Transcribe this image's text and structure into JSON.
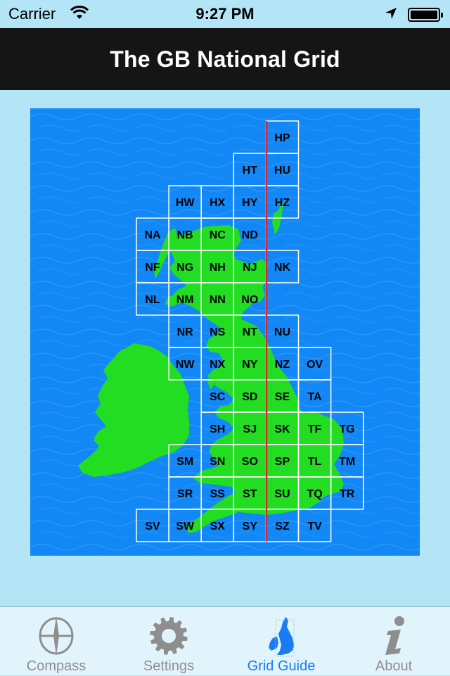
{
  "status_bar": {
    "carrier": "Carrier",
    "time": "9:27 PM",
    "wifi_icon": "wifi-icon",
    "location_icon": "location-arrow-icon",
    "battery_icon": "battery-full-icon"
  },
  "nav": {
    "title": "The GB National Grid"
  },
  "map": {
    "colors": {
      "sea": "#1287f6",
      "land": "#22dd22",
      "grid_line": "#ffffff",
      "meridian": "#e0222a"
    },
    "cells": [
      {
        "label": "HP",
        "col": 4,
        "row": 0
      },
      {
        "label": "HT",
        "col": 3,
        "row": 1
      },
      {
        "label": "HU",
        "col": 4,
        "row": 1
      },
      {
        "label": "HW",
        "col": 1,
        "row": 2
      },
      {
        "label": "HX",
        "col": 2,
        "row": 2
      },
      {
        "label": "HY",
        "col": 3,
        "row": 2
      },
      {
        "label": "HZ",
        "col": 4,
        "row": 2
      },
      {
        "label": "NA",
        "col": 0,
        "row": 3
      },
      {
        "label": "NB",
        "col": 1,
        "row": 3
      },
      {
        "label": "NC",
        "col": 2,
        "row": 3
      },
      {
        "label": "ND",
        "col": 3,
        "row": 3
      },
      {
        "label": "NF",
        "col": 0,
        "row": 4
      },
      {
        "label": "NG",
        "col": 1,
        "row": 4
      },
      {
        "label": "NH",
        "col": 2,
        "row": 4
      },
      {
        "label": "NJ",
        "col": 3,
        "row": 4
      },
      {
        "label": "NK",
        "col": 4,
        "row": 4
      },
      {
        "label": "NL",
        "col": 0,
        "row": 5
      },
      {
        "label": "NM",
        "col": 1,
        "row": 5
      },
      {
        "label": "NN",
        "col": 2,
        "row": 5
      },
      {
        "label": "NO",
        "col": 3,
        "row": 5
      },
      {
        "label": "NR",
        "col": 1,
        "row": 6
      },
      {
        "label": "NS",
        "col": 2,
        "row": 6
      },
      {
        "label": "NT",
        "col": 3,
        "row": 6
      },
      {
        "label": "NU",
        "col": 4,
        "row": 6
      },
      {
        "label": "NW",
        "col": 1,
        "row": 7
      },
      {
        "label": "NX",
        "col": 2,
        "row": 7
      },
      {
        "label": "NY",
        "col": 3,
        "row": 7
      },
      {
        "label": "NZ",
        "col": 4,
        "row": 7
      },
      {
        "label": "OV",
        "col": 5,
        "row": 7
      },
      {
        "label": "SC",
        "col": 2,
        "row": 8
      },
      {
        "label": "SD",
        "col": 3,
        "row": 8
      },
      {
        "label": "SE",
        "col": 4,
        "row": 8
      },
      {
        "label": "TA",
        "col": 5,
        "row": 8
      },
      {
        "label": "SH",
        "col": 2,
        "row": 9
      },
      {
        "label": "SJ",
        "col": 3,
        "row": 9
      },
      {
        "label": "SK",
        "col": 4,
        "row": 9
      },
      {
        "label": "TF",
        "col": 5,
        "row": 9
      },
      {
        "label": "TG",
        "col": 6,
        "row": 9
      },
      {
        "label": "SM",
        "col": 1,
        "row": 10
      },
      {
        "label": "SN",
        "col": 2,
        "row": 10
      },
      {
        "label": "SO",
        "col": 3,
        "row": 10
      },
      {
        "label": "SP",
        "col": 4,
        "row": 10
      },
      {
        "label": "TL",
        "col": 5,
        "row": 10
      },
      {
        "label": "TM",
        "col": 6,
        "row": 10
      },
      {
        "label": "SR",
        "col": 1,
        "row": 11
      },
      {
        "label": "SS",
        "col": 2,
        "row": 11
      },
      {
        "label": "ST",
        "col": 3,
        "row": 11
      },
      {
        "label": "SU",
        "col": 4,
        "row": 11
      },
      {
        "label": "TQ",
        "col": 5,
        "row": 11
      },
      {
        "label": "TR",
        "col": 6,
        "row": 11
      },
      {
        "label": "SV",
        "col": 0,
        "row": 12
      },
      {
        "label": "SW",
        "col": 1,
        "row": 12
      },
      {
        "label": "SX",
        "col": 2,
        "row": 12
      },
      {
        "label": "SY",
        "col": 3,
        "row": 12
      },
      {
        "label": "SZ",
        "col": 4,
        "row": 12
      },
      {
        "label": "TV",
        "col": 5,
        "row": 12
      }
    ]
  },
  "tab_bar": {
    "active_color": "#1a7cf2",
    "inactive_color": "#8e8e8e",
    "items": [
      {
        "label": "Compass",
        "icon": "compass-icon",
        "active": false
      },
      {
        "label": "Settings",
        "icon": "gear-icon",
        "active": false
      },
      {
        "label": "Grid Guide",
        "icon": "british-isles-map-icon",
        "active": true
      },
      {
        "label": "About",
        "icon": "info-icon",
        "active": false
      }
    ]
  }
}
